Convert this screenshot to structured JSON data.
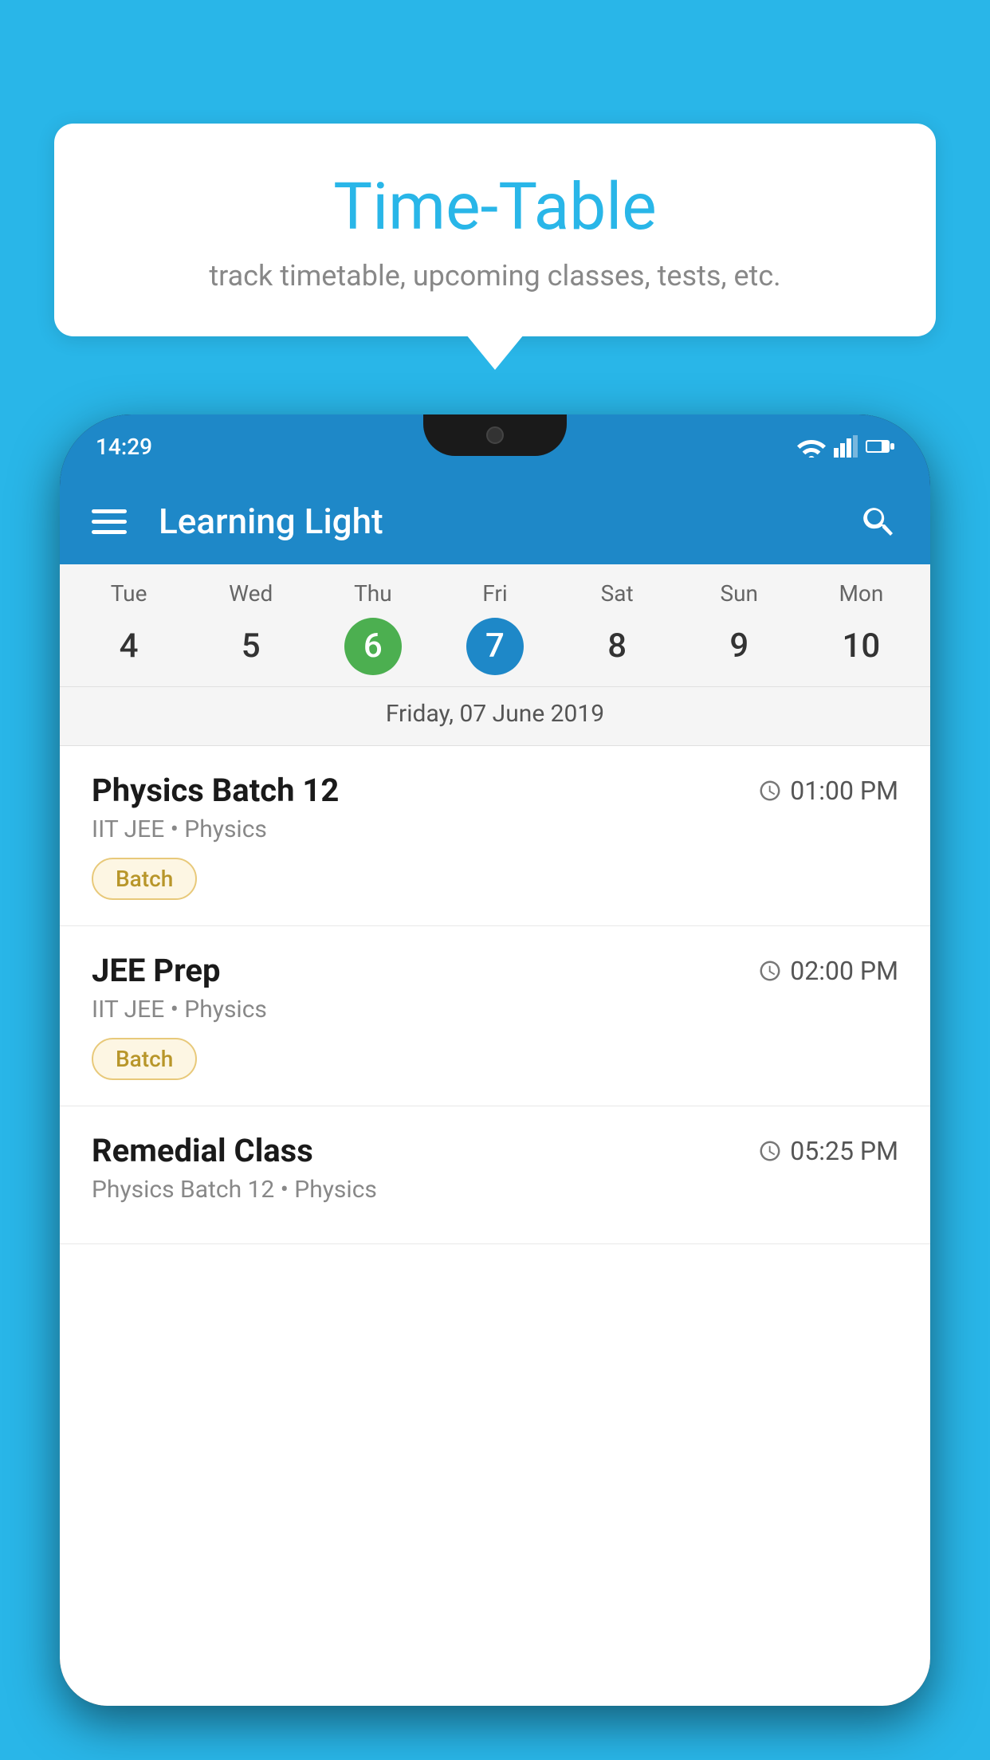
{
  "background_color": "#29B6E8",
  "tooltip": {
    "title": "Time-Table",
    "subtitle": "track timetable, upcoming classes, tests, etc."
  },
  "phone": {
    "status_time": "14:29",
    "app_name": "Learning Light",
    "calendar": {
      "days": [
        {
          "name": "Tue",
          "num": "4",
          "state": "normal"
        },
        {
          "name": "Wed",
          "num": "5",
          "state": "normal"
        },
        {
          "name": "Thu",
          "num": "6",
          "state": "today"
        },
        {
          "name": "Fri",
          "num": "7",
          "state": "selected"
        },
        {
          "name": "Sat",
          "num": "8",
          "state": "normal"
        },
        {
          "name": "Sun",
          "num": "9",
          "state": "normal"
        },
        {
          "name": "Mon",
          "num": "10",
          "state": "normal"
        }
      ],
      "selected_date_label": "Friday, 07 June 2019"
    },
    "schedule": [
      {
        "title": "Physics Batch 12",
        "time": "01:00 PM",
        "subtitle": "IIT JEE • Physics",
        "badge": "Batch"
      },
      {
        "title": "JEE Prep",
        "time": "02:00 PM",
        "subtitle": "IIT JEE • Physics",
        "badge": "Batch"
      },
      {
        "title": "Remedial Class",
        "time": "05:25 PM",
        "subtitle": "Physics Batch 12 • Physics",
        "badge": null
      }
    ]
  }
}
